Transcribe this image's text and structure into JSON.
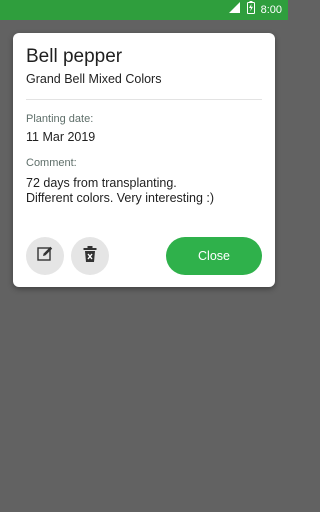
{
  "status_bar": {
    "time": "8:00",
    "color": "#2f9e3d",
    "icons": [
      "wifi-icon",
      "battery-icon"
    ]
  },
  "dialog": {
    "title": "Bell pepper",
    "subtitle": "Grand Bell Mixed Colors",
    "planting_label": "Planting date:",
    "planting_date": "11 Mar 2019",
    "comment_label": "Comment:",
    "comment_lines": [
      "72 days from transplanting.",
      "Different colors. Very interesting :)"
    ],
    "edit_icon": "edit-icon",
    "delete_icon": "delete-icon",
    "close_label": "Close",
    "accent_color": "#2fb14b"
  }
}
